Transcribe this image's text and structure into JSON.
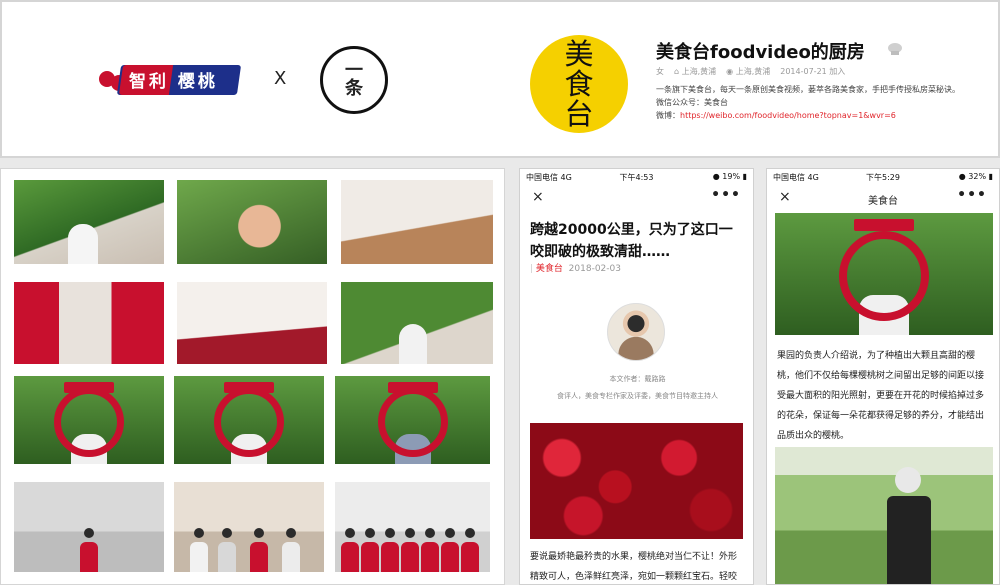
{
  "header": {
    "brand_text": "智利 樱桃",
    "cross": "X",
    "yitiao": [
      "一",
      "条"
    ],
    "meishitai": [
      "美",
      "食",
      "台"
    ],
    "profile": {
      "name": "美食台foodvideo的厨房",
      "gender": "女",
      "hometown": "上海,黄浦",
      "location": "上海,黄浦",
      "joined": "2014-07-21 加入",
      "desc": "一条旗下美食台，每天一条原创美食视频，蒌萃各路美食家，手把手传授私房菜秘诀。",
      "wechat": "微信公众号：美食台",
      "weibo_label": "微博：",
      "weibo_url": "https://weibo.com/foodvideo/home?topnav=1&wvr=6"
    }
  },
  "phone1": {
    "status": {
      "carrier": "中国电信  4G",
      "time": "下午4:53",
      "battery": "19%"
    },
    "nav": {
      "close": "×",
      "more": "•••"
    },
    "title": "跨越20000公里，只为了这口一咬即破的极致清甜……",
    "meta_author": "美食台",
    "meta_date": "2018-02-03",
    "author_line": "本文作者：戴路路",
    "author_bio": "食评人，美食专栏作家及评委，美食节目特邀主持人",
    "body": "要说最娇艳最矜贵的水果，樱桃绝对当仁不让！外形精致可人，色泽鲜红亮泽，宛如一颗颗红宝石。轻咬一"
  },
  "phone2": {
    "status": {
      "carrier": "中国电信  4G",
      "time": "下午5:29",
      "battery": "32%"
    },
    "nav": {
      "close": "×",
      "title": "美食台",
      "more": "•••"
    },
    "body": "果园的负责人介绍说，为了种植出大颗且高甜的樱桃，他们不仅给每棵樱桃树之间留出足够的间距以接受最大面积的阳光照射，更要在开花的时候掐掉过多的花朵，保证每一朵花都获得足够的养分，才能结出品质出众的樱桃。"
  },
  "colors": {
    "brand_red": "#c8102e",
    "brand_blue": "#1d2f8a",
    "meishitai_yellow": "#f5d000",
    "link_red": "#e0262c"
  }
}
